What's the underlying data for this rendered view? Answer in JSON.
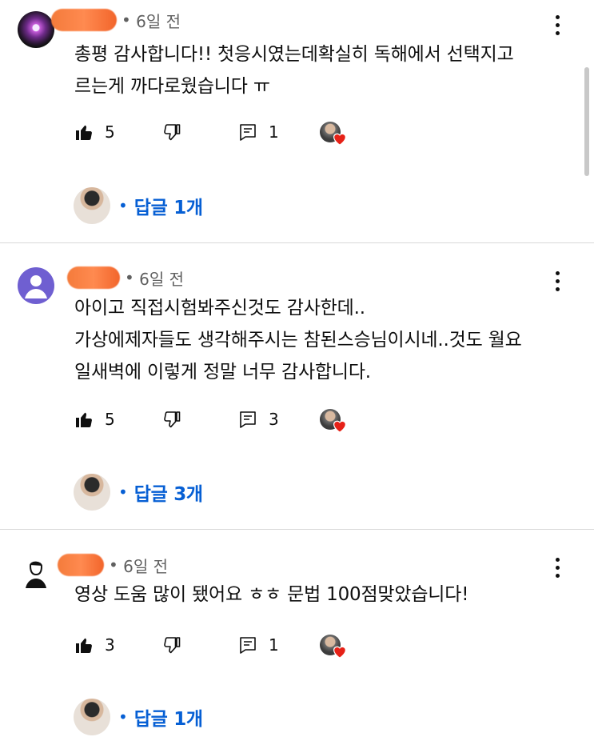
{
  "comments": [
    {
      "time": "6일 전",
      "text": "총평 감사합니다!! 첫응시였는데확실히 독해에서 선택지고\n르는게 까다로웠습니다 ㅠ",
      "likes": "5",
      "replies_count": "1",
      "replies_label": "답글 1개"
    },
    {
      "time": "6일 전",
      "text": "아이고 직접시험봐주신것도 감사한데..\n가상에제자들도 생각해주시는 참된스승님이시네..것도 월요\n일새벽에 이렇게 정말 너무 감사합니다.",
      "likes": "5",
      "replies_count": "3",
      "replies_label": "답글 3개"
    },
    {
      "time": "6일 전",
      "text": "영상 도움 많이 됐어요 ㅎㅎ 문법 100점맞았습니다!",
      "likes": "3",
      "replies_count": "1",
      "replies_label": "답글 1개"
    }
  ],
  "colors": {
    "link": "#065fd4",
    "meta": "#606060",
    "heart": "#e62117"
  },
  "icons": [
    "like-icon",
    "dislike-icon",
    "reply-icon",
    "more-vert-icon",
    "creator-heart-icon"
  ]
}
